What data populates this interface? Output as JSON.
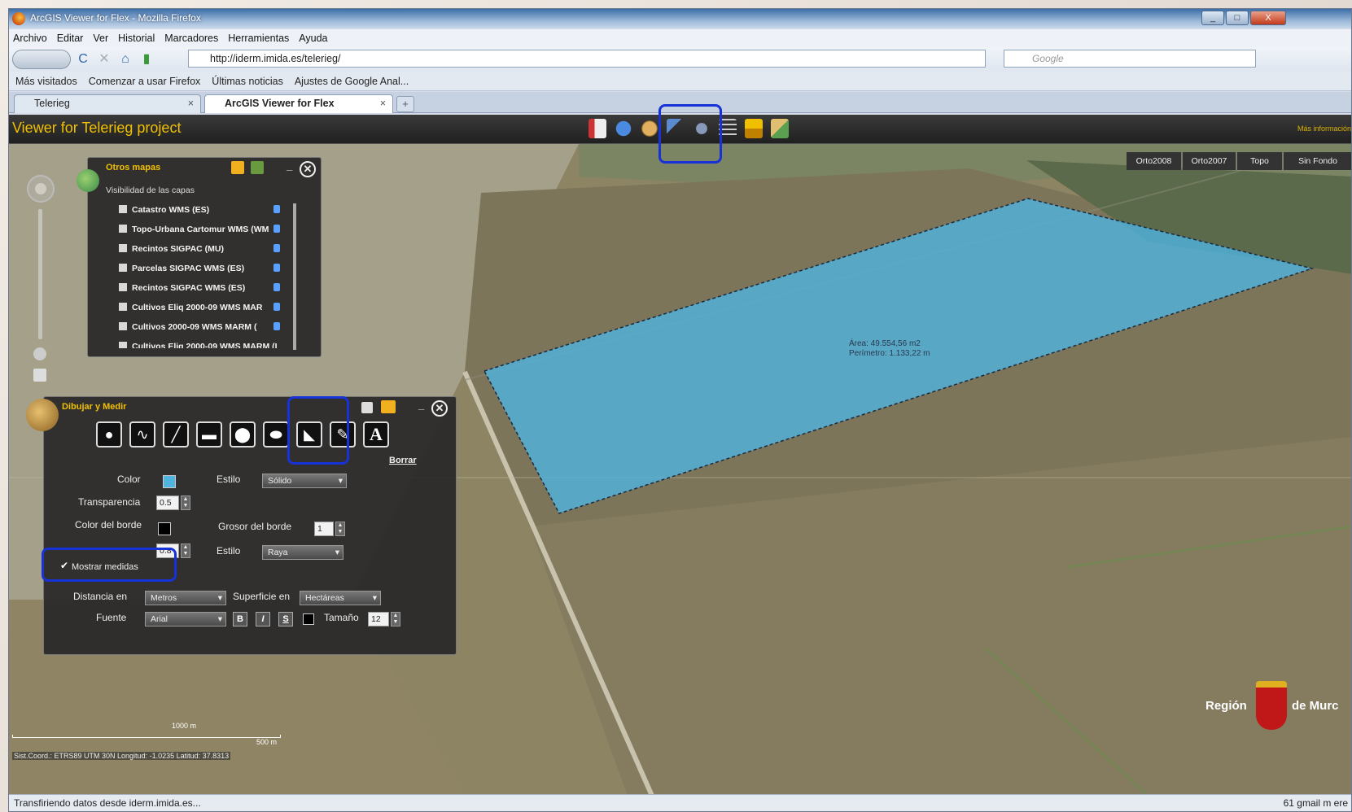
{
  "window": {
    "title": "ArcGIS Viewer for Flex - Mozilla Firefox",
    "min_label": "_",
    "max_label": "□",
    "close_label": "X"
  },
  "menu": [
    "Archivo",
    "Editar",
    "Ver",
    "Historial",
    "Marcadores",
    "Herramientas",
    "Ayuda"
  ],
  "nav": {
    "back_label": "",
    "reload_icon": "C",
    "stop_icon": "✕",
    "home_icon": "⌂",
    "url": "http://iderm.imida.es/telerieg/",
    "search_placeholder": "Google"
  },
  "bookmarks": [
    "Más visitados",
    "Comenzar a usar Firefox",
    "Últimas noticias",
    "Ajustes de Google Anal..."
  ],
  "tabs": [
    {
      "label": "Telerieg",
      "close": "×"
    },
    {
      "label": "ArcGIS Viewer for Flex",
      "close": "×"
    }
  ],
  "newtab_label": "+",
  "app": {
    "title": "Viewer for Telerieg project",
    "more_info": "Más información",
    "basemaps": [
      "Orto2008",
      "Orto2007",
      "Topo",
      "Sin Fondo"
    ]
  },
  "layers_panel": {
    "title": "Otros mapas",
    "subtitle": "Visibilidad de las capas",
    "close_label": "✕",
    "minimize_label": "_",
    "layers": [
      "Catastro WMS (ES)",
      "Topo-Urbana Cartomur WMS (WM",
      "Recintos SIGPAC (MU)",
      "Parcelas SIGPAC WMS (ES)",
      "Recintos SIGPAC WMS (ES)",
      "Cultivos Eliq 2000-09 WMS MAR",
      "Cultivos 2000-09 WMS MARM (",
      "Cultivos Eliq 2000-09 WMS MARM (I"
    ]
  },
  "draw_panel": {
    "title": "Dibujar y Medir",
    "close_label": "✕",
    "minimize_label": "_",
    "clear_label": "Borrar",
    "tools": [
      {
        "name": "point",
        "glyph": "●"
      },
      {
        "name": "polyline",
        "glyph": "∿"
      },
      {
        "name": "freehand-line",
        "glyph": "╱"
      },
      {
        "name": "rectangle",
        "glyph": "▬"
      },
      {
        "name": "circle",
        "glyph": "⬤"
      },
      {
        "name": "ellipse",
        "glyph": "⬬"
      },
      {
        "name": "polygon",
        "glyph": "◣"
      },
      {
        "name": "freehand-polygon",
        "glyph": "✎"
      },
      {
        "name": "text",
        "glyph": "A"
      }
    ],
    "color_label": "Color",
    "style_label": "Estilo",
    "style_value": "Sólido",
    "transparency_label": "Transparencia",
    "transparency_value": "0.5",
    "border_color_label": "Color del borde",
    "border_width_label": "Grosor del borde",
    "border_width_value": "1",
    "border_alpha_value": "0.8",
    "border_style_label": "Estilo",
    "border_style_value": "Raya",
    "show_measures_label": "Mostrar medidas",
    "distance_label": "Distancia en",
    "distance_value": "Metros",
    "area_label": "Superficie en",
    "area_value": "Hectáreas",
    "font_label": "Fuente",
    "font_value": "Arial",
    "bold_label": "B",
    "italic_label": "I",
    "underline_label": "S",
    "size_label": "Tamaño",
    "size_value": "12"
  },
  "measurement": {
    "area": "Área: 49.554,56 m2",
    "perimeter": "Perímetro: 1.133,22 m"
  },
  "scale": {
    "label_top": "1000 m",
    "label_right": "500 m"
  },
  "coords": "Sist.Coord.: ETRS89 UTM 30N  Longitud: -1.0235  Latitud: 37.8313",
  "logo": {
    "left_text": "Región",
    "right_text": "de Murc"
  },
  "status": {
    "text": "Transfiriendo datos desde iderm.imida.es...",
    "right": "61 gmail m ere"
  },
  "colors": {
    "accent_gold": "#f0c000",
    "highlight_blue": "#1732d6",
    "polygon_fill": "#4fb4e0"
  }
}
